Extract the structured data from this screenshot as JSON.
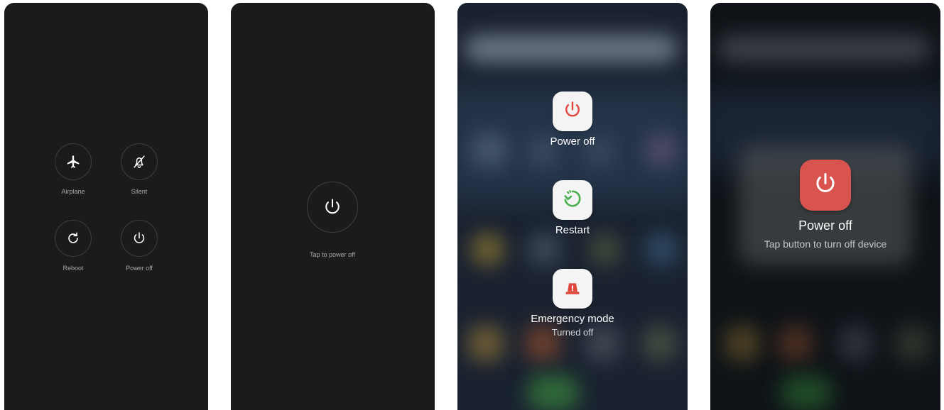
{
  "screen1": {
    "buttons": [
      {
        "label": "Airplane",
        "icon": "airplane-icon"
      },
      {
        "label": "Silent",
        "icon": "bell-off-icon"
      },
      {
        "label": "Reboot",
        "icon": "reboot-icon"
      },
      {
        "label": "Power off",
        "icon": "power-icon"
      }
    ]
  },
  "screen2": {
    "hint": "Tap to power off",
    "icon": "power-icon"
  },
  "screen3": {
    "power_off": {
      "label": "Power off",
      "icon": "power-icon",
      "color": "#e0463b"
    },
    "restart": {
      "label": "Restart",
      "icon": "restart-icon",
      "color": "#4caf50"
    },
    "emergency": {
      "label": "Emergency mode",
      "status": "Turned off",
      "icon": "emergency-siren-icon",
      "color": "#e0463b"
    }
  },
  "screen4": {
    "label": "Power off",
    "hint": "Tap button to turn off device",
    "icon": "power-icon",
    "accent": "#d9534f"
  }
}
